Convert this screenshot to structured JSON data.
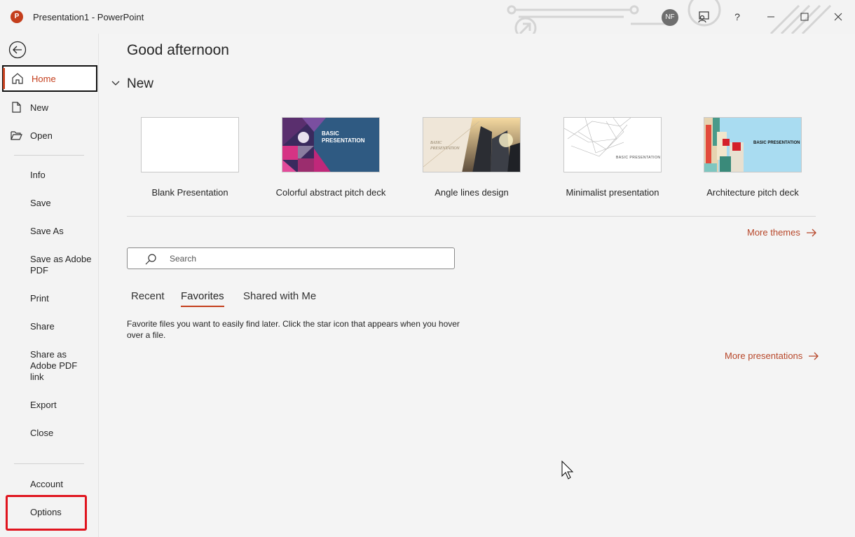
{
  "window": {
    "title": "Presentation1  -  PowerPoint",
    "app_icon": "powerpoint-icon",
    "user_initials": "NF",
    "buttons": [
      "coauthor-icon",
      "help-icon",
      "minimize-icon",
      "maximize-icon",
      "close-icon"
    ],
    "help_label": "?"
  },
  "sidebar": {
    "back_icon": "back-arrow-icon",
    "items": [
      {
        "label": "Home",
        "icon": "home-icon"
      },
      {
        "label": "New",
        "icon": "new-file-icon"
      },
      {
        "label": "Open",
        "icon": "folder-open-icon"
      },
      {
        "label": "Info"
      },
      {
        "label": "Save"
      },
      {
        "label": "Save As"
      },
      {
        "label": "Save as Adobe PDF"
      },
      {
        "label": "Print"
      },
      {
        "label": "Share"
      },
      {
        "label": "Share as Adobe PDF link"
      },
      {
        "label": "Export"
      },
      {
        "label": "Close"
      },
      {
        "label": "Account"
      },
      {
        "label": "Options"
      }
    ]
  },
  "main": {
    "greeting": "Good afternoon",
    "new_section": "New",
    "templates": [
      {
        "label": "Blank Presentation"
      },
      {
        "label": "Colorful abstract pitch deck",
        "thumb_text": "BASIC\nPRESENTATION"
      },
      {
        "label": "Angle lines design",
        "thumb_text": "BASIC\nPRESENTATION"
      },
      {
        "label": "Minimalist presentation",
        "thumb_text": "BASIC PRESENTATION"
      },
      {
        "label": "Architecture pitch deck",
        "thumb_text": "BASIC\nPRESENTATION"
      }
    ],
    "more_themes": "More themes",
    "search_placeholder": "Search",
    "tabs": [
      {
        "label": "Recent",
        "active": false
      },
      {
        "label": "Favorites",
        "active": true
      },
      {
        "label": "Shared with Me",
        "active": false
      }
    ],
    "favorites_text": "Favorite files you want to easily find later. Click the star icon that appears when you hover over a file.",
    "more_presentations": "More presentations"
  },
  "colors": {
    "accent": "#c43e1c",
    "link": "#b7472a",
    "highlight_box": "#e0141e"
  }
}
